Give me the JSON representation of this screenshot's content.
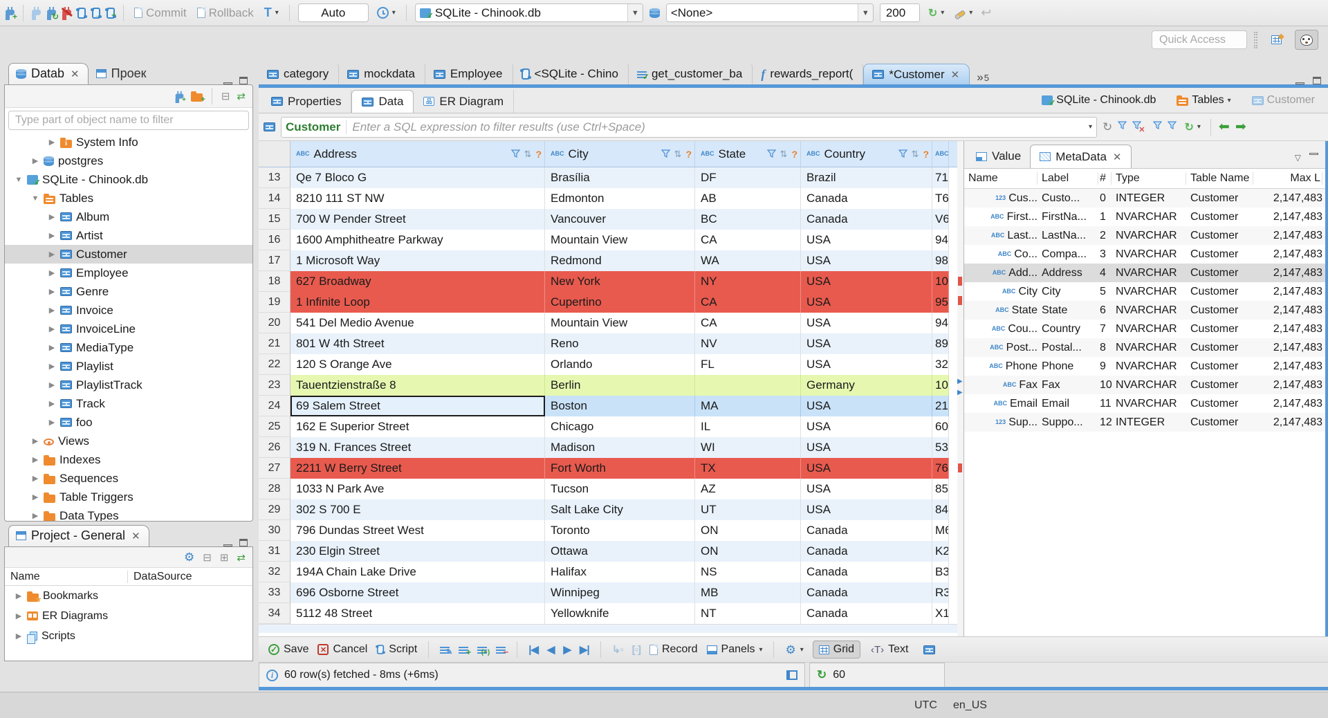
{
  "colors": {
    "accent_blue": "#5698d8",
    "modified_row": "#e85a4e",
    "new_row": "#e6f8b0",
    "selected_row": "#c9e2f8"
  },
  "topbar": {
    "commit": "Commit",
    "rollback": "Rollback",
    "auto": "Auto",
    "connection": "SQLite - Chinook.db",
    "schema": "<None>",
    "fetch_size": "200",
    "quick_access": "Quick Access"
  },
  "navigator": {
    "tab_database": "Datab",
    "tab_project": "Проек",
    "filter_placeholder": "Type part of object name to filter",
    "tree": [
      {
        "label": "System Info",
        "icon": "folder-info",
        "depth": 2,
        "arrow": "right"
      },
      {
        "label": "postgres",
        "icon": "db",
        "depth": 1,
        "arrow": "right"
      },
      {
        "label": "SQLite - Chinook.db",
        "icon": "sqlite",
        "depth": 0,
        "arrow": "down"
      },
      {
        "label": "Tables",
        "icon": "folder-table",
        "depth": 1,
        "arrow": "down"
      },
      {
        "label": "Album",
        "icon": "table",
        "depth": 2,
        "arrow": "right"
      },
      {
        "label": "Artist",
        "icon": "table",
        "depth": 2,
        "arrow": "right"
      },
      {
        "label": "Customer",
        "icon": "table",
        "depth": 2,
        "arrow": "right",
        "selected": true
      },
      {
        "label": "Employee",
        "icon": "table",
        "depth": 2,
        "arrow": "right"
      },
      {
        "label": "Genre",
        "icon": "table",
        "depth": 2,
        "arrow": "right"
      },
      {
        "label": "Invoice",
        "icon": "table",
        "depth": 2,
        "arrow": "right"
      },
      {
        "label": "InvoiceLine",
        "icon": "table",
        "depth": 2,
        "arrow": "right"
      },
      {
        "label": "MediaType",
        "icon": "table",
        "depth": 2,
        "arrow": "right"
      },
      {
        "label": "Playlist",
        "icon": "table",
        "depth": 2,
        "arrow": "right"
      },
      {
        "label": "PlaylistTrack",
        "icon": "table",
        "depth": 2,
        "arrow": "right"
      },
      {
        "label": "Track",
        "icon": "table",
        "depth": 2,
        "arrow": "right"
      },
      {
        "label": "foo",
        "icon": "table",
        "depth": 2,
        "arrow": "right"
      },
      {
        "label": "Views",
        "icon": "eye",
        "depth": 1,
        "arrow": "right"
      },
      {
        "label": "Indexes",
        "icon": "folder",
        "depth": 1,
        "arrow": "right"
      },
      {
        "label": "Sequences",
        "icon": "folder",
        "depth": 1,
        "arrow": "right"
      },
      {
        "label": "Table Triggers",
        "icon": "folder",
        "depth": 1,
        "arrow": "right"
      },
      {
        "label": "Data Types",
        "icon": "folder",
        "depth": 1,
        "arrow": "right"
      }
    ]
  },
  "project": {
    "tab": "Project - General",
    "col_name": "Name",
    "col_datasource": "DataSource",
    "items": [
      {
        "label": "Bookmarks",
        "icon": "folder-star"
      },
      {
        "label": "ER Diagrams",
        "icon": "er"
      },
      {
        "label": "Scripts",
        "icon": "scripts"
      }
    ]
  },
  "editor": {
    "tabs": [
      {
        "label": "category",
        "icon": "table"
      },
      {
        "label": "mockdata",
        "icon": "table"
      },
      {
        "label": "Employee",
        "icon": "table"
      },
      {
        "label": "<SQLite - Chino",
        "icon": "sql"
      },
      {
        "label": "get_customer_ba",
        "icon": "sql-check"
      },
      {
        "label": "rewards_report(",
        "icon": "fn"
      },
      {
        "label": "*Customer",
        "icon": "table",
        "active": true,
        "closable": true
      }
    ],
    "more_tabs": "5",
    "subtabs": [
      {
        "label": "Properties",
        "icon": "table"
      },
      {
        "label": "Data",
        "icon": "table",
        "active": true
      },
      {
        "label": "ER Diagram",
        "icon": "er-diagram"
      }
    ],
    "breadcrumb": [
      {
        "label": "SQLite - Chinook.db",
        "icon": "sqlite"
      },
      {
        "label": "Tables",
        "icon": "folder-table",
        "dropdown": true
      },
      {
        "label": "Customer",
        "icon": "table-light",
        "muted": true
      }
    ]
  },
  "filterbar": {
    "table": "Customer",
    "placeholder": "Enter a SQL expression to filter results (use Ctrl+Space)"
  },
  "grid": {
    "columns": [
      "Address",
      "City",
      "State",
      "Country"
    ],
    "rows": [
      {
        "num": "13",
        "address": "Qe 7 Bloco G",
        "city": "Brasília",
        "state": "DF",
        "country": "Brazil",
        "extra": "71",
        "bg": "alt"
      },
      {
        "num": "14",
        "address": "8210 111 ST NW",
        "city": "Edmonton",
        "state": "AB",
        "country": "Canada",
        "extra": "T6",
        "bg": "plain"
      },
      {
        "num": "15",
        "address": "700 W Pender Street",
        "city": "Vancouver",
        "state": "BC",
        "country": "Canada",
        "extra": "V6",
        "bg": "alt"
      },
      {
        "num": "16",
        "address": "1600 Amphitheatre Parkway",
        "city": "Mountain View",
        "state": "CA",
        "country": "USA",
        "extra": "94",
        "bg": "plain"
      },
      {
        "num": "17",
        "address": "1 Microsoft Way",
        "city": "Redmond",
        "state": "WA",
        "country": "USA",
        "extra": "98",
        "bg": "alt"
      },
      {
        "num": "18",
        "address": "627 Broadway",
        "city": "New York",
        "state": "NY",
        "country": "USA",
        "extra": "10",
        "bg": "mod"
      },
      {
        "num": "19",
        "address": "1 Infinite Loop",
        "city": "Cupertino",
        "state": "CA",
        "country": "USA",
        "extra": "95",
        "bg": "mod"
      },
      {
        "num": "20",
        "address": "541 Del Medio Avenue",
        "city": "Mountain View",
        "state": "CA",
        "country": "USA",
        "extra": "94",
        "bg": "plain"
      },
      {
        "num": "21",
        "address": "801 W 4th Street",
        "city": "Reno",
        "state": "NV",
        "country": "USA",
        "extra": "89",
        "bg": "alt"
      },
      {
        "num": "22",
        "address": "120 S Orange Ave",
        "city": "Orlando",
        "state": "FL",
        "country": "USA",
        "extra": "32",
        "bg": "plain"
      },
      {
        "num": "23",
        "address": "Tauentzienstraße 8",
        "city": "Berlin",
        "state": "",
        "country": "Germany",
        "extra": "10",
        "bg": "new"
      },
      {
        "num": "24",
        "address": "69 Salem Street",
        "city": "Boston",
        "state": "MA",
        "country": "USA",
        "extra": "21",
        "bg": "sel"
      },
      {
        "num": "25",
        "address": "162 E Superior Street",
        "city": "Chicago",
        "state": "IL",
        "country": "USA",
        "extra": "60",
        "bg": "plain"
      },
      {
        "num": "26",
        "address": "319 N. Frances Street",
        "city": "Madison",
        "state": "WI",
        "country": "USA",
        "extra": "53",
        "bg": "alt"
      },
      {
        "num": "27",
        "address": "2211 W Berry Street",
        "city": "Fort Worth",
        "state": "TX",
        "country": "USA",
        "extra": "76",
        "bg": "mod"
      },
      {
        "num": "28",
        "address": "1033 N Park Ave",
        "city": "Tucson",
        "state": "AZ",
        "country": "USA",
        "extra": "85",
        "bg": "plain"
      },
      {
        "num": "29",
        "address": "302 S 700 E",
        "city": "Salt Lake City",
        "state": "UT",
        "country": "USA",
        "extra": "84",
        "bg": "alt"
      },
      {
        "num": "30",
        "address": "796 Dundas Street West",
        "city": "Toronto",
        "state": "ON",
        "country": "Canada",
        "extra": "M6",
        "bg": "plain"
      },
      {
        "num": "31",
        "address": "230 Elgin Street",
        "city": "Ottawa",
        "state": "ON",
        "country": "Canada",
        "extra": "K2",
        "bg": "alt"
      },
      {
        "num": "32",
        "address": "194A Chain Lake Drive",
        "city": "Halifax",
        "state": "NS",
        "country": "Canada",
        "extra": "B3",
        "bg": "plain"
      },
      {
        "num": "33",
        "address": "696 Osborne Street",
        "city": "Winnipeg",
        "state": "MB",
        "country": "Canada",
        "extra": "R3",
        "bg": "alt"
      },
      {
        "num": "34",
        "address": "5112 48 Street",
        "city": "Yellowknife",
        "state": "NT",
        "country": "Canada",
        "extra": "X1",
        "bg": "plain"
      }
    ]
  },
  "panel": {
    "tab_value": "Value",
    "tab_metadata": "MetaData",
    "columns": [
      "Name",
      "Label",
      "#",
      "Type",
      "Table Name",
      "Max L"
    ],
    "rows": [
      {
        "icon": "123",
        "name": "Cus...",
        "label": "Custo...",
        "num": "0",
        "type": "INTEGER",
        "table": "Customer",
        "max": "2,147,483"
      },
      {
        "icon": "abc",
        "name": "First...",
        "label": "FirstNa...",
        "num": "1",
        "type": "NVARCHAR",
        "table": "Customer",
        "max": "2,147,483"
      },
      {
        "icon": "abc",
        "name": "Last...",
        "label": "LastNa...",
        "num": "2",
        "type": "NVARCHAR",
        "table": "Customer",
        "max": "2,147,483"
      },
      {
        "icon": "abc",
        "name": "Co...",
        "label": "Compa...",
        "num": "3",
        "type": "NVARCHAR",
        "table": "Customer",
        "max": "2,147,483"
      },
      {
        "icon": "abc",
        "name": "Add...",
        "label": "Address",
        "num": "4",
        "type": "NVARCHAR",
        "table": "Customer",
        "max": "2,147,483",
        "selected": true
      },
      {
        "icon": "abc",
        "name": "City",
        "label": "City",
        "num": "5",
        "type": "NVARCHAR",
        "table": "Customer",
        "max": "2,147,483"
      },
      {
        "icon": "abc",
        "name": "State",
        "label": "State",
        "num": "6",
        "type": "NVARCHAR",
        "table": "Customer",
        "max": "2,147,483"
      },
      {
        "icon": "abc",
        "name": "Cou...",
        "label": "Country",
        "num": "7",
        "type": "NVARCHAR",
        "table": "Customer",
        "max": "2,147,483"
      },
      {
        "icon": "abc",
        "name": "Post...",
        "label": "Postal...",
        "num": "8",
        "type": "NVARCHAR",
        "table": "Customer",
        "max": "2,147,483"
      },
      {
        "icon": "abc",
        "name": "Phone",
        "label": "Phone",
        "num": "9",
        "type": "NVARCHAR",
        "table": "Customer",
        "max": "2,147,483"
      },
      {
        "icon": "abc",
        "name": "Fax",
        "label": "Fax",
        "num": "10",
        "type": "NVARCHAR",
        "table": "Customer",
        "max": "2,147,483"
      },
      {
        "icon": "abc",
        "name": "Email",
        "label": "Email",
        "num": "11",
        "type": "NVARCHAR",
        "table": "Customer",
        "max": "2,147,483"
      },
      {
        "icon": "123",
        "name": "Sup...",
        "label": "Suppo...",
        "num": "12",
        "type": "INTEGER",
        "table": "Customer",
        "max": "2,147,483"
      }
    ]
  },
  "bottombar": {
    "save": "Save",
    "cancel": "Cancel",
    "script": "Script",
    "record": "Record",
    "panels": "Panels",
    "grid": "Grid",
    "text": "Text",
    "status": "60 row(s) fetched - 8ms (+6ms)",
    "refresh_value": "60"
  },
  "statusbar": {
    "timezone": "UTC",
    "locale": "en_US"
  }
}
